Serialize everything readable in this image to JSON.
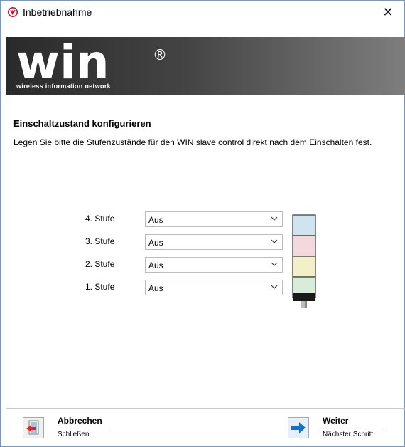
{
  "window": {
    "title": "Inbetriebnahme"
  },
  "banner": {
    "logo_text": "win",
    "logo_mark": "®",
    "logo_subtitle": "wireless information network"
  },
  "page": {
    "heading": "Einschaltzustand konfigurieren",
    "description": "Legen Sie bitte die Stufenzustände für den WIN slave control direkt nach dem Einschalten fest."
  },
  "stages": [
    {
      "label": "4. Stufe",
      "value": "Aus",
      "color": "#cfe4ef"
    },
    {
      "label": "3. Stufe",
      "value": "Aus",
      "color": "#f3d9de"
    },
    {
      "label": "2. Stufe",
      "value": "Aus",
      "color": "#f2efc9"
    },
    {
      "label": "1. Stufe",
      "value": "Aus",
      "color": "#d7ecd9"
    }
  ],
  "footer": {
    "cancel": {
      "title": "Abbrechen",
      "subtitle": "Schließen",
      "icon": "cancel-exit-icon"
    },
    "next": {
      "title": "Weiter",
      "subtitle": "Nächster Schritt",
      "icon": "arrow-right-icon"
    }
  },
  "colors": {
    "accent": "#1e6fc0",
    "banner_dark": "#2a2a2a",
    "window_border": "#6a9cd3"
  }
}
